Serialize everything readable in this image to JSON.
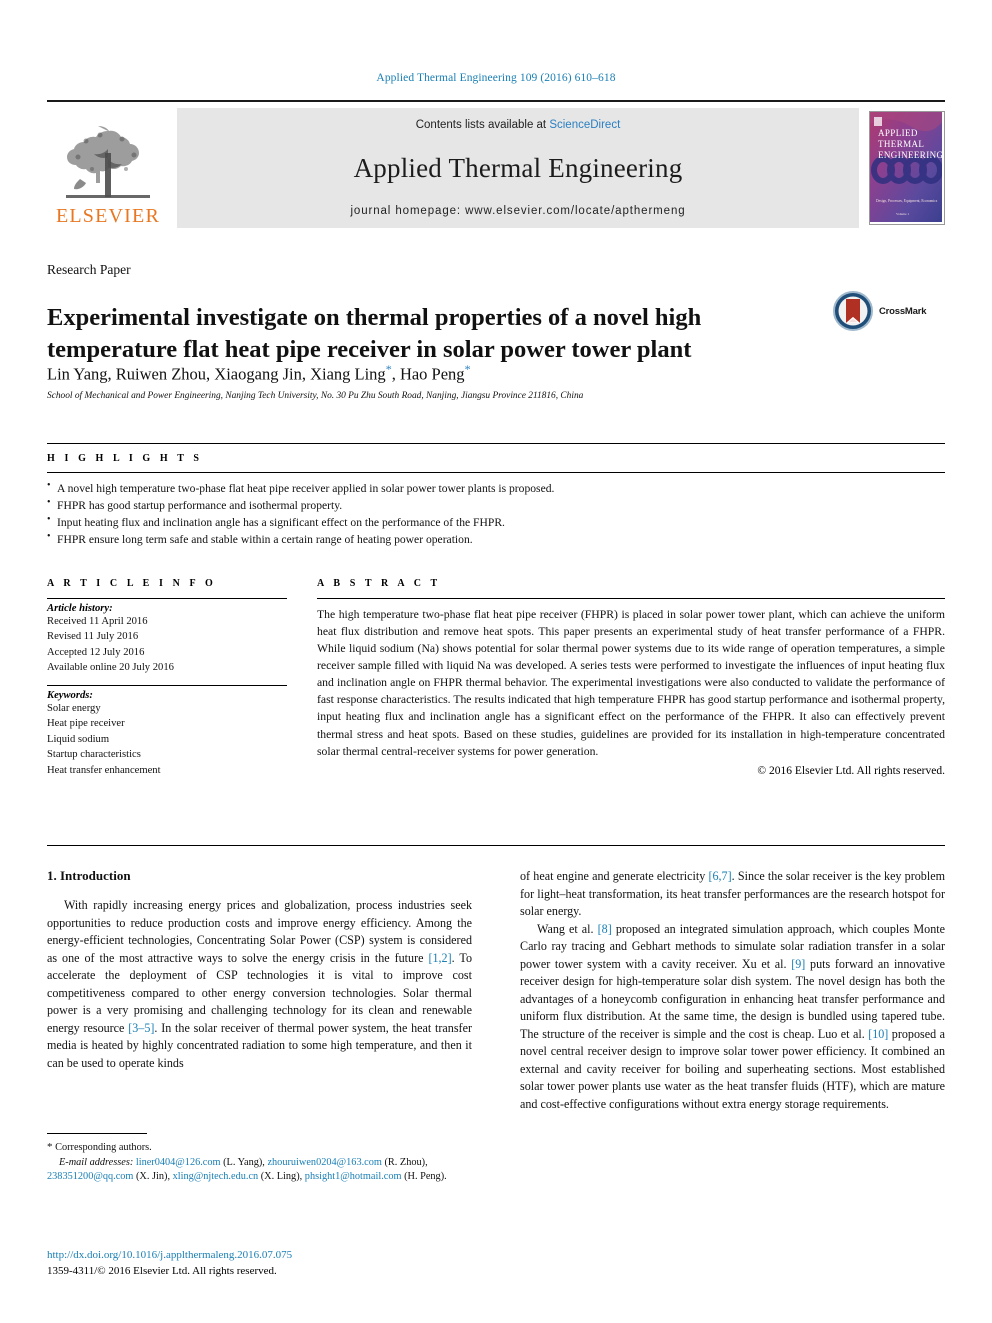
{
  "running_head": "Applied Thermal Engineering 109 (2016) 610–618",
  "masthead": {
    "contents_prefix": "Contents lists available at ",
    "sciencedirect": "ScienceDirect",
    "journal_name": "Applied Thermal Engineering",
    "homepage": "journal homepage: www.elsevier.com/locate/apthermeng",
    "publisher_wordmark": "ELSEVIER",
    "cover_title_line1": "APPLIED",
    "cover_title_line2": "THERMAL",
    "cover_title_line3": "ENGINEERING",
    "cover_footer": "Design, Processes, Equipment, Economics",
    "publisher_color": "#E87722",
    "link_color": "#2a7fc1"
  },
  "article": {
    "type": "Research Paper",
    "title": "Experimental investigate on thermal properties of a novel high temperature flat heat pipe receiver in solar power tower plant",
    "authors": "Lin Yang, Ruiwen Zhou, Xiaogang Jin, Xiang Ling",
    "authors_tail": ", Hao Peng",
    "affiliation": "School of Mechanical and Power Engineering, Nanjing Tech University, No. 30 Pu Zhu South Road, Nanjing, Jiangsu Province 211816, China",
    "crossmark_label": "CrossMark"
  },
  "highlights": {
    "heading": "H I G H L I G H T S",
    "items": [
      "A novel high temperature two-phase flat heat pipe receiver applied in solar power tower plants is proposed.",
      "FHPR has good startup performance and isothermal property.",
      "Input heating flux and inclination angle has a significant effect on the performance of the FHPR.",
      "FHPR ensure long term safe and stable within a certain range of heating power operation."
    ]
  },
  "article_info": {
    "heading": "A R T I C L E    I N F O",
    "history_label": "Article history:",
    "history": [
      "Received 11 April 2016",
      "Revised 11 July 2016",
      "Accepted 12 July 2016",
      "Available online 20 July 2016"
    ],
    "keywords_label": "Keywords:",
    "keywords": [
      "Solar energy",
      "Heat pipe receiver",
      "Liquid sodium",
      "Startup characteristics",
      "Heat transfer enhancement"
    ]
  },
  "abstract": {
    "heading": "A B S T R A C T",
    "body": "The high temperature two-phase flat heat pipe receiver (FHPR) is placed in solar power tower plant, which can achieve the uniform heat flux distribution and remove heat spots. This paper presents an experimental study of heat transfer performance of a FHPR. While liquid sodium (Na) shows potential for solar thermal power systems due to its wide range of operation temperatures, a simple receiver sample filled with liquid Na was developed. A series tests were performed to investigate the influences of input heating flux and inclination angle on FHPR thermal behavior. The experimental investigations were also conducted to validate the performance of fast response characteristics. The results indicated that high temperature FHPR has good startup performance and isothermal property, input heating flux and inclination angle has a significant effect on the performance of the FHPR. It also can effectively prevent thermal stress and heat spots. Based on these studies, guidelines are provided for its installation in high-temperature concentrated solar thermal central-receiver systems for power generation.",
    "copyright": "© 2016 Elsevier Ltd. All rights reserved."
  },
  "introduction": {
    "heading": "1. Introduction",
    "left_para_1_a": "With rapidly increasing energy prices and globalization, process industries seek opportunities to reduce production costs and improve energy efficiency. Among the energy-efficient technologies, Concentrating Solar Power (CSP) system is considered as one of the most attractive ways to solve the energy crisis in the future ",
    "left_ref_1": "[1,2]",
    "left_para_1_b": ". To accelerate the deployment of CSP technologies it is vital to improve cost competitiveness compared to other energy conversion technologies. Solar thermal power is a very promising and challenging technology for its clean and renewable energy resource ",
    "left_ref_2": "[3–5]",
    "left_para_1_c": ". In the solar receiver of thermal power system, the heat transfer media is heated by highly concentrated radiation to some high temperature, and then it can be used to operate kinds",
    "right_para_1_a": "of heat engine and generate electricity ",
    "right_ref_1": "[6,7]",
    "right_para_1_b": ". Since the solar receiver is the key problem for light–heat transformation, its heat transfer performances are the research hotspot for solar energy.",
    "right_para_2_a": "Wang et al. ",
    "right_ref_2": "[8]",
    "right_para_2_b": " proposed an integrated simulation approach, which couples Monte Carlo ray tracing and Gebhart methods to simulate solar radiation transfer in a solar power tower system with a cavity receiver. Xu et al. ",
    "right_ref_3": "[9]",
    "right_para_2_c": " puts forward an innovative receiver design for high-temperature solar dish system. The novel design has both the advantages of a honeycomb configuration in enhancing heat transfer performance and uniform flux distribution. At the same time, the design is bundled using tapered tube. The structure of the receiver is simple and the cost is cheap. Luo et al. ",
    "right_ref_4": "[10]",
    "right_para_2_d": " proposed a novel central receiver design to improve solar tower power efficiency. It combined an external and cavity receiver for boiling and superheating sections. Most established solar tower power plants use water as the heat transfer fluids (HTF), which are mature and cost-effective configurations without extra energy storage requirements."
  },
  "footnote": {
    "corresponding": "Corresponding authors.",
    "email_label": "E-mail addresses:",
    "emails": [
      {
        "addr": "liner0404@126.com",
        "who": "(L. Yang),"
      },
      {
        "addr": "zhouruiwen0204@163.com",
        "who": "(R. Zhou),"
      },
      {
        "addr": "238351200@qq.com",
        "who": "(X. Jin),"
      },
      {
        "addr": "xling@njtech.edu.cn",
        "who": "(X. Ling),"
      },
      {
        "addr": "phsight1@hotmail.com",
        "who": "(H. Peng)."
      }
    ],
    "doi": "http://dx.doi.org/10.1016/j.applthermaleng.2016.07.075",
    "issn_line": "1359-4311/© 2016 Elsevier Ltd. All rights reserved."
  }
}
